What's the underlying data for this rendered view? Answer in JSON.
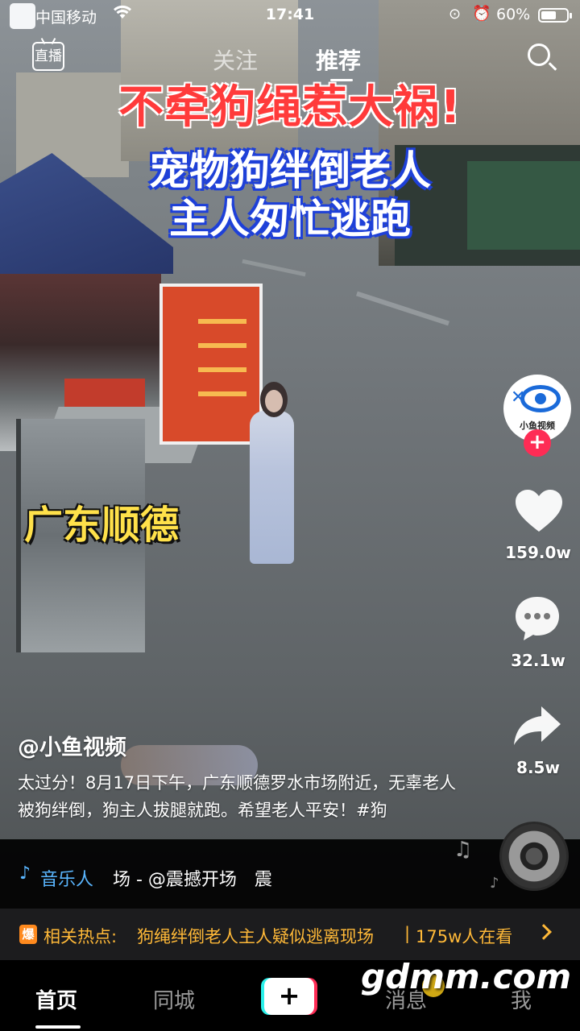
{
  "status_bar": {
    "carrier": "中国移动",
    "time": "17:41",
    "battery_percent": "60%",
    "battery_level": 0.6
  },
  "top_nav": {
    "live_label": "直播",
    "tabs": [
      {
        "label": "关注",
        "active": false
      },
      {
        "label": "推荐",
        "active": true
      }
    ],
    "search_icon": "search-icon"
  },
  "video": {
    "captions": {
      "headline": "不牵狗绳惹大祸!",
      "line2": "宠物狗绊倒老人",
      "line3": "主人匆忙逃跑",
      "location": "广东顺德"
    }
  },
  "actions": {
    "avatar_text": "小鱼视频",
    "likes": "159.0w",
    "comments": "32.1w",
    "shares": "8.5w",
    "colors": {
      "follow_plus": "#fe2c55",
      "accent_blue": "#5ab6ff"
    }
  },
  "post": {
    "author": "@小鱼视频",
    "description": "太过分！8月17日下午，广东顺德罗水市场附近，无辜老人被狗绊倒，狗主人拔腿就跑。希望老人平安！#狗",
    "music_label": "音乐人",
    "music_text": "场 - @震撼开场　震"
  },
  "hot_topic": {
    "badge": "爆",
    "label": "相关热点:",
    "topic": "狗绳绊倒老人主人疑似逃离现场",
    "separator": "|",
    "views": "175w人在看"
  },
  "tab_bar": {
    "home": "首页",
    "city": "同城",
    "add": "+",
    "messages": "消息",
    "me": "我"
  },
  "watermark": "gdmm.com"
}
